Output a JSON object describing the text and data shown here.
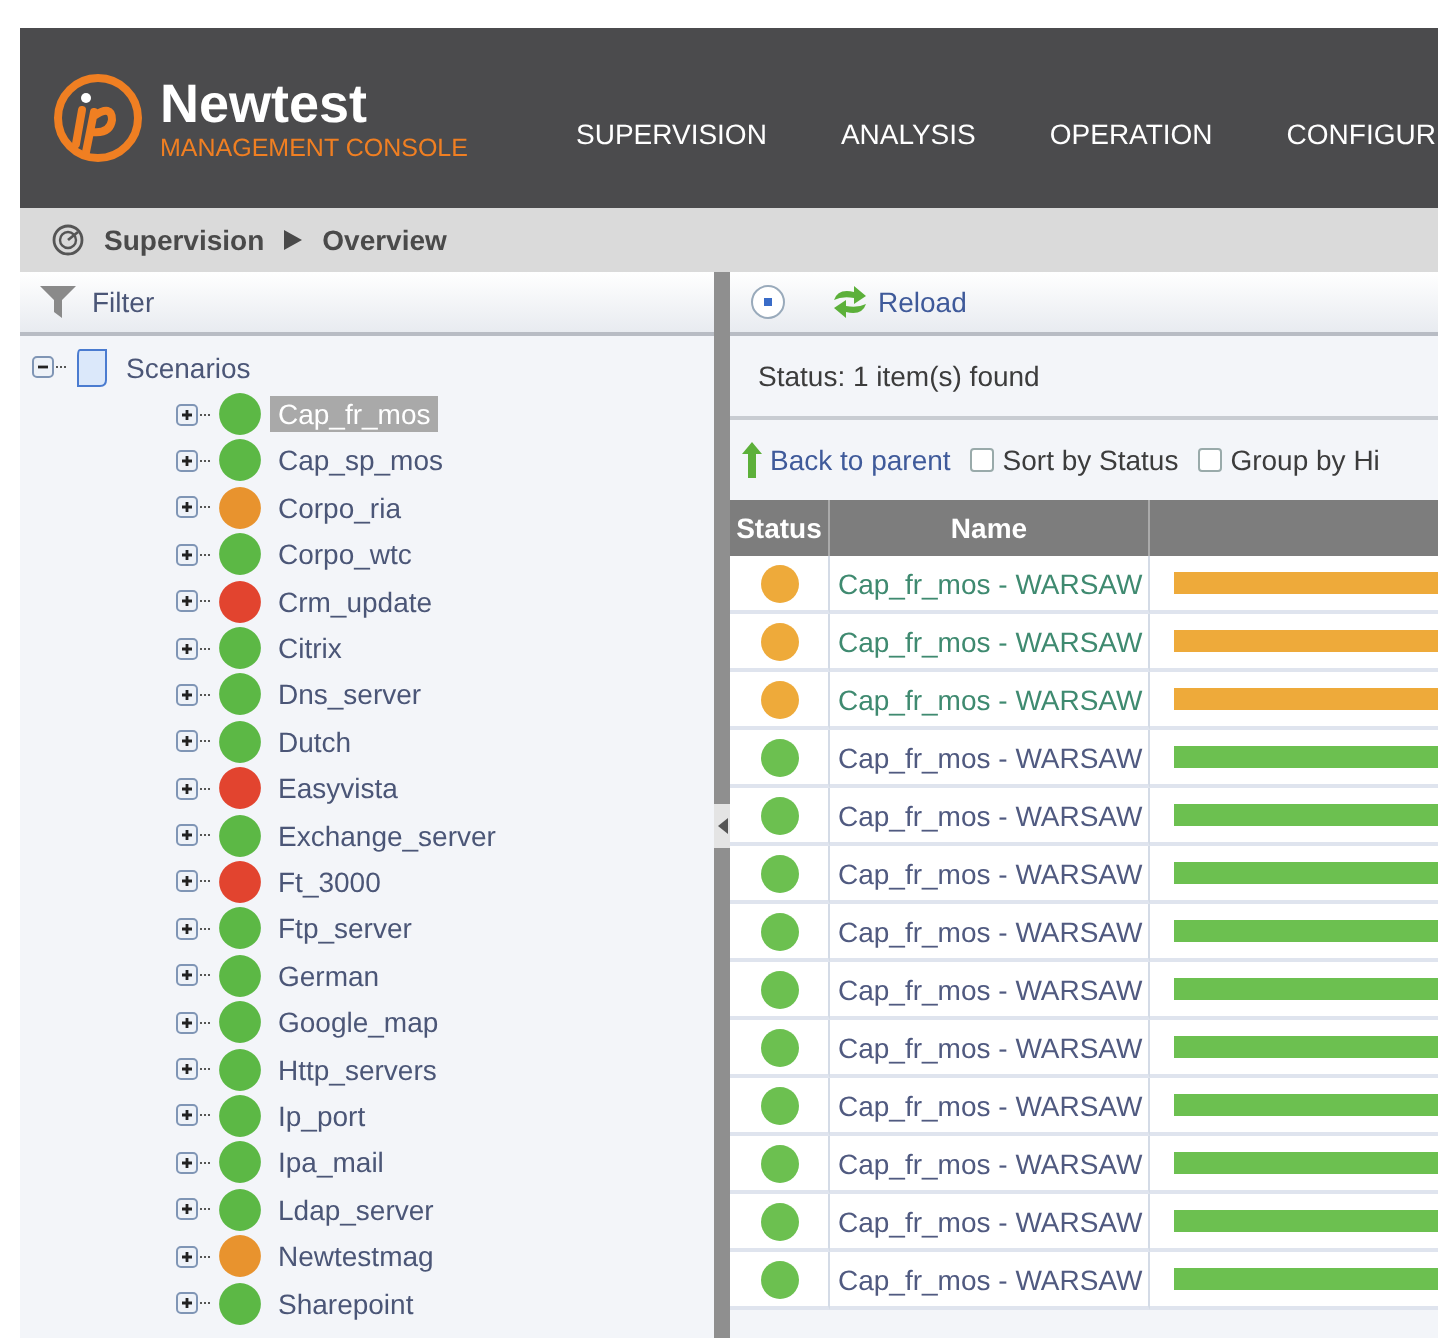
{
  "header": {
    "brand": "Newtest",
    "subtitle": "MANAGEMENT CONSOLE",
    "nav": [
      {
        "label": "SUPERVISION",
        "selected": false
      },
      {
        "label": "ANALYSIS",
        "selected": false
      },
      {
        "label": "OPERATION",
        "selected": false
      },
      {
        "label": "CONFIGUR",
        "selected": false
      }
    ]
  },
  "breadcrumb": [
    "Supervision",
    "Overview"
  ],
  "sidebar": {
    "filter": "Filter",
    "root": {
      "label": "Scenarios",
      "expanded": true,
      "children": [
        {
          "label": "Cap_fr_mos",
          "color": "#5cb845",
          "selected": true
        },
        {
          "label": "Cap_sp_mos",
          "color": "#5cb845",
          "selected": false
        },
        {
          "label": "Corpo_ria",
          "color": "#e8932e",
          "selected": false
        },
        {
          "label": "Corpo_wtc",
          "color": "#5cb845",
          "selected": false
        },
        {
          "label": "Crm_update",
          "color": "#e2442f",
          "selected": false
        },
        {
          "label": "Citrix",
          "color": "#5cb845",
          "selected": false
        },
        {
          "label": "Dns_server",
          "color": "#5cb845",
          "selected": false
        },
        {
          "label": "Dutch",
          "color": "#5cb845",
          "selected": false
        },
        {
          "label": "Easyvista",
          "color": "#e2442f",
          "selected": false
        },
        {
          "label": "Exchange_server",
          "color": "#5cb845",
          "selected": false
        },
        {
          "label": "Ft_3000",
          "color": "#e2442f",
          "selected": false
        },
        {
          "label": "Ftp_server",
          "color": "#5cb845",
          "selected": false
        },
        {
          "label": "German",
          "color": "#5cb845",
          "selected": false
        },
        {
          "label": "Google_map",
          "color": "#5cb845",
          "selected": false
        },
        {
          "label": "Http_servers",
          "color": "#5cb845",
          "selected": false
        },
        {
          "label": "Ip_port",
          "color": "#5cb845",
          "selected": false
        },
        {
          "label": "Ipa_mail",
          "color": "#5cb845",
          "selected": false
        },
        {
          "label": "Ldap_server",
          "color": "#5cb845",
          "selected": false
        },
        {
          "label": "Newtestmag",
          "color": "#e8932e",
          "selected": false
        },
        {
          "label": "Sharepoint",
          "color": "#5cb845",
          "selected": false
        }
      ]
    }
  },
  "main": {
    "reload": "Reload",
    "status": "Status: 1 item(s) found",
    "back": "Back to parent",
    "options": [
      {
        "label": "Sort by Status",
        "checked": false
      },
      {
        "label": "Group by Hi",
        "checked": false
      }
    ],
    "table": {
      "columns": [
        "Status",
        "Name"
      ],
      "rows": [
        {
          "color": "#eeaa3a",
          "highlighted": true,
          "name": "Cap_fr_mos - WARSAW"
        },
        {
          "color": "#eeaa3a",
          "highlighted": true,
          "name": "Cap_fr_mos - WARSAW"
        },
        {
          "color": "#eeaa3a",
          "highlighted": true,
          "name": "Cap_fr_mos - WARSAW"
        },
        {
          "color": "#6cc050",
          "highlighted": false,
          "name": "Cap_fr_mos - WARSAW"
        },
        {
          "color": "#6cc050",
          "highlighted": false,
          "name": "Cap_fr_mos - WARSAW"
        },
        {
          "color": "#6cc050",
          "highlighted": false,
          "name": "Cap_fr_mos - WARSAW"
        },
        {
          "color": "#6cc050",
          "highlighted": false,
          "name": "Cap_fr_mos - WARSAW"
        },
        {
          "color": "#6cc050",
          "highlighted": false,
          "name": "Cap_fr_mos - WARSAW"
        },
        {
          "color": "#6cc050",
          "highlighted": false,
          "name": "Cap_fr_mos - WARSAW"
        },
        {
          "color": "#6cc050",
          "highlighted": false,
          "name": "Cap_fr_mos - WARSAW"
        },
        {
          "color": "#6cc050",
          "highlighted": false,
          "name": "Cap_fr_mos - WARSAW"
        },
        {
          "color": "#6cc050",
          "highlighted": false,
          "name": "Cap_fr_mos - WARSAW"
        },
        {
          "color": "#6cc050",
          "highlighted": false,
          "name": "Cap_fr_mos - WARSAW"
        }
      ]
    }
  }
}
